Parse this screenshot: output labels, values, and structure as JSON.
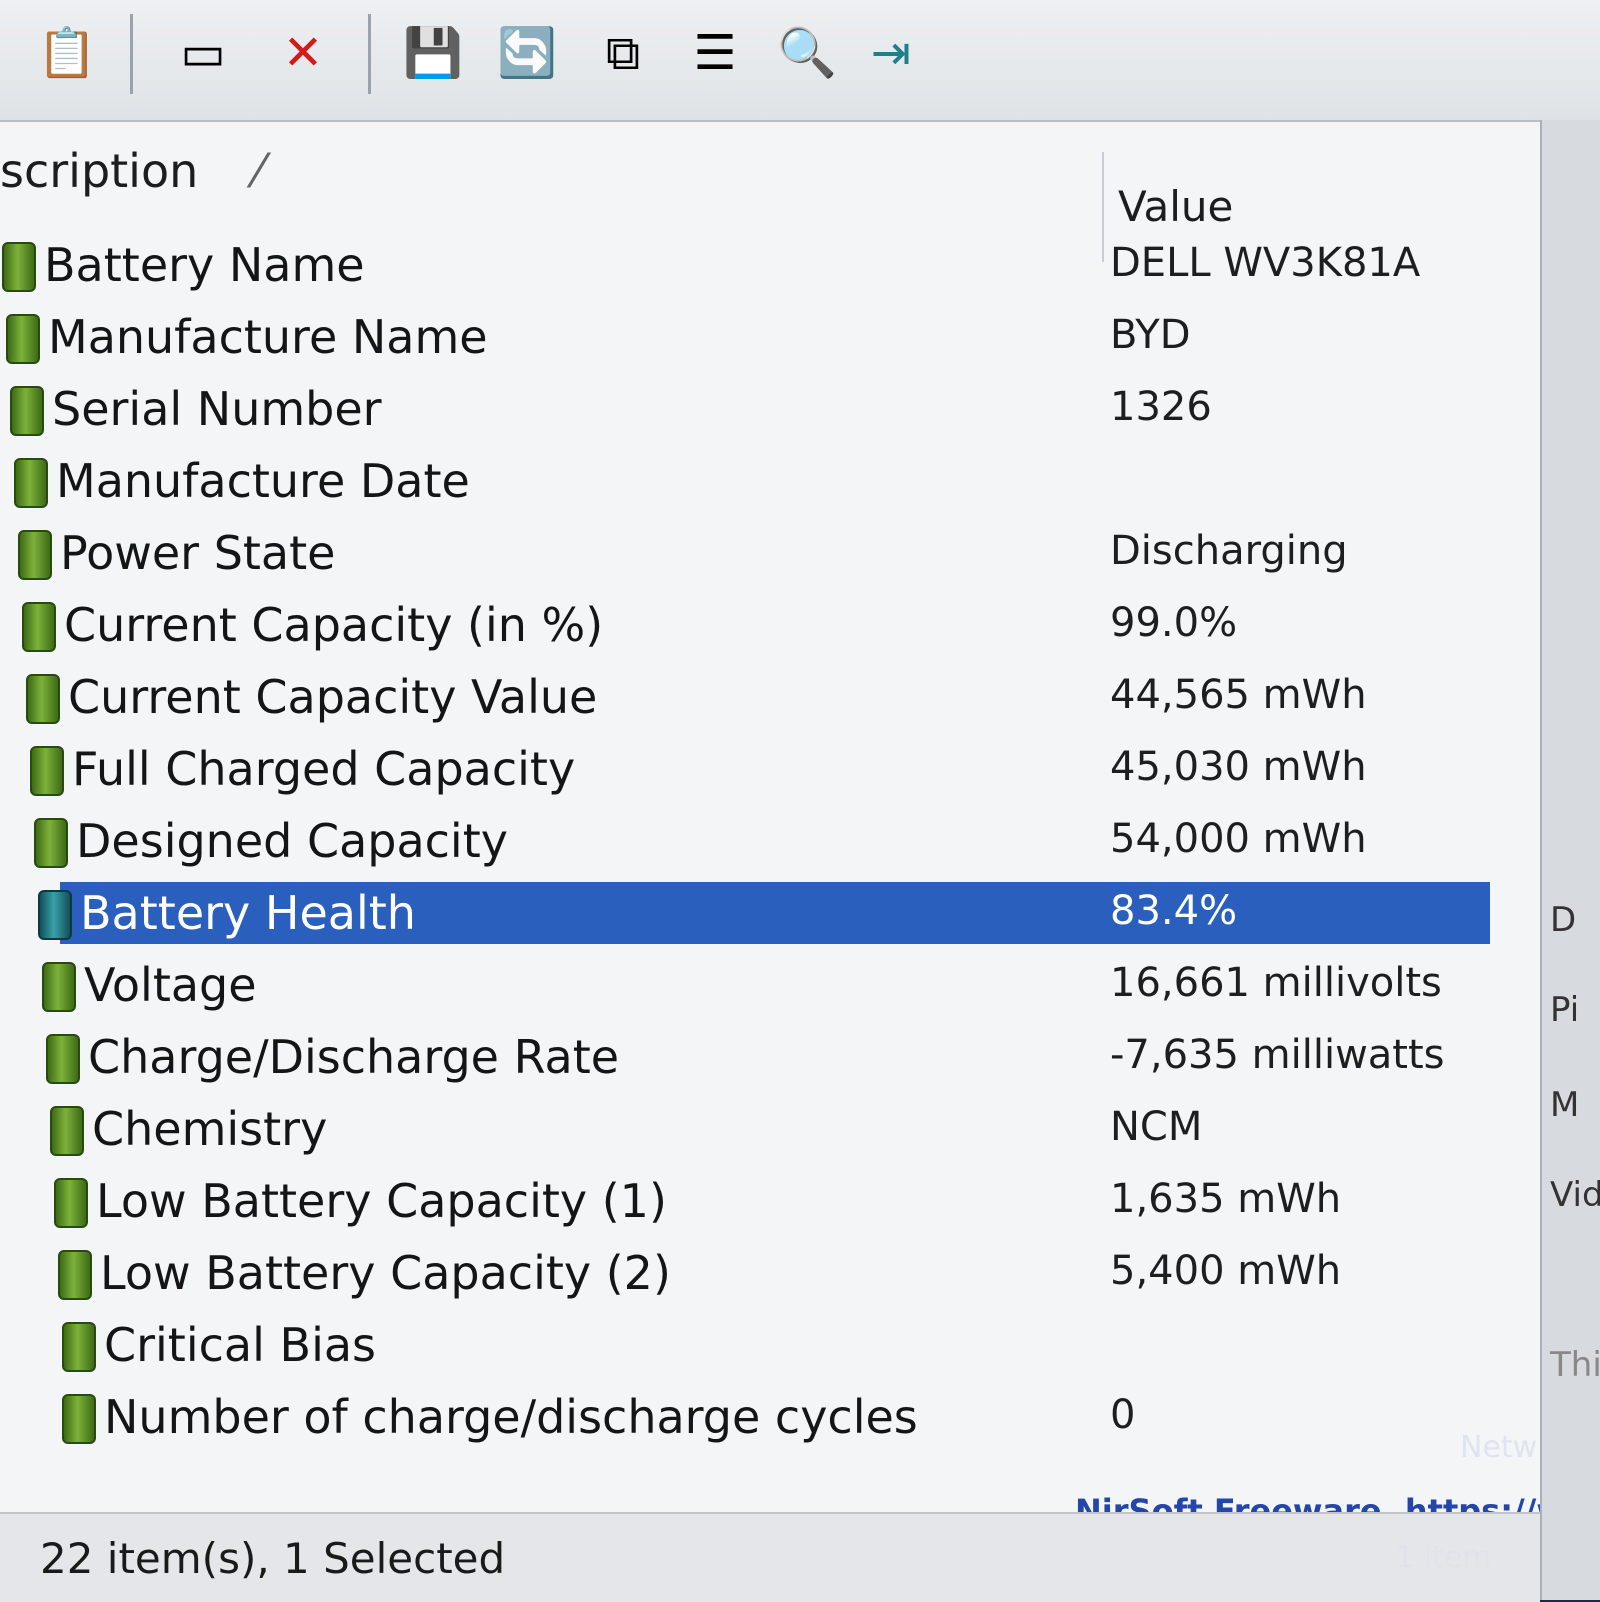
{
  "toolbar": {
    "buttons": [
      {
        "name": "properties-icon",
        "glyph": "📋"
      },
      {
        "name": "html-report-icon",
        "glyph": "▭"
      },
      {
        "name": "delete-icon",
        "glyph": "✕"
      },
      {
        "name": "save-icon",
        "glyph": "💾"
      },
      {
        "name": "refresh-icon",
        "glyph": "🔄"
      },
      {
        "name": "copy-icon",
        "glyph": "⧉"
      },
      {
        "name": "options-icon",
        "glyph": "☰"
      },
      {
        "name": "find-icon",
        "glyph": "🔍"
      },
      {
        "name": "exit-icon",
        "glyph": "⇥"
      }
    ]
  },
  "columns": {
    "description": "scription",
    "value": "Value"
  },
  "rows": [
    {
      "description": "Battery Name",
      "value": "DELL WV3K81A"
    },
    {
      "description": "Manufacture Name",
      "value": "BYD"
    },
    {
      "description": "Serial Number",
      "value": "1326"
    },
    {
      "description": "Manufacture Date",
      "value": ""
    },
    {
      "description": "Power State",
      "value": "Discharging"
    },
    {
      "description": "Current Capacity (in %)",
      "value": "99.0%"
    },
    {
      "description": "Current Capacity Value",
      "value": "44,565 mWh"
    },
    {
      "description": "Full Charged Capacity",
      "value": "45,030 mWh"
    },
    {
      "description": "Designed Capacity",
      "value": "54,000 mWh"
    },
    {
      "description": "Battery Health",
      "value": "83.4%",
      "selected": true
    },
    {
      "description": "Voltage",
      "value": "16,661 millivolts"
    },
    {
      "description": "Charge/Discharge Rate",
      "value": "-7,635 milliwatts"
    },
    {
      "description": "Chemistry",
      "value": "NCM"
    },
    {
      "description": "Low Battery Capacity (1)",
      "value": "1,635 mWh"
    },
    {
      "description": "Low Battery Capacity (2)",
      "value": "5,400 mWh"
    },
    {
      "description": "Critical Bias",
      "value": ""
    },
    {
      "description": "Number of charge/discharge cycles",
      "value": "0"
    }
  ],
  "status": {
    "items": "22 item(s), 1 Selected",
    "link": "NirSoft Freeware. https://w"
  },
  "right_panel": {
    "labels": [
      "D",
      "Pi",
      "M",
      "Vid",
      "This"
    ],
    "network": "Netw",
    "count": "1 item"
  },
  "colors": {
    "selection": "#2a5fbd",
    "link": "#2446a8"
  }
}
